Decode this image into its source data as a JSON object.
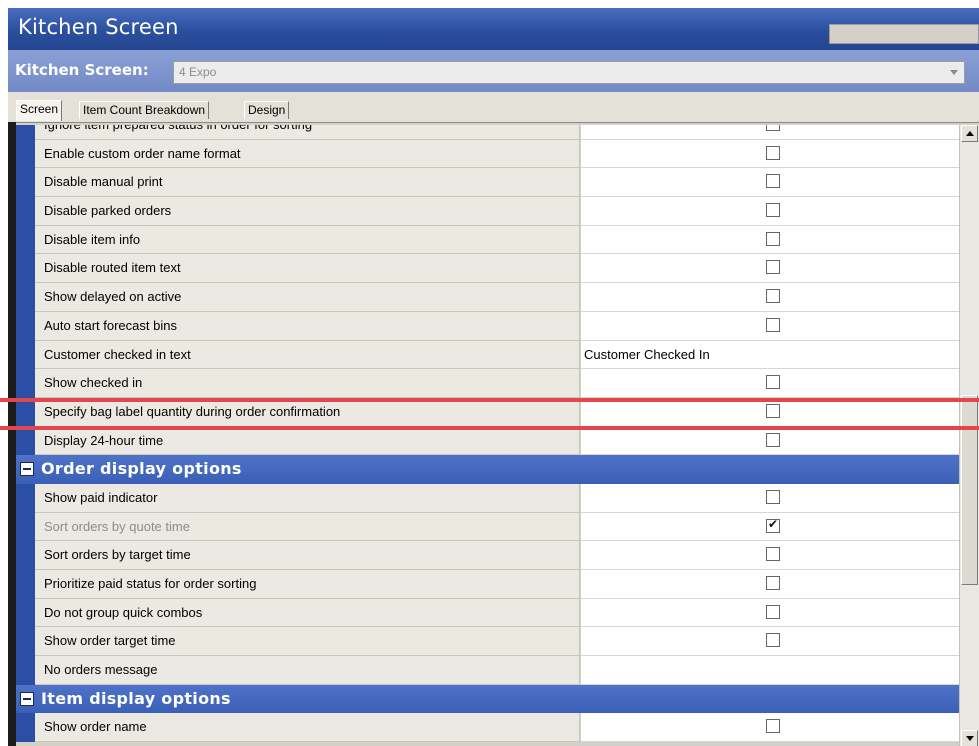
{
  "window": {
    "title": "Kitchen Screen"
  },
  "selector": {
    "label": "Kitchen Screen:",
    "value": "4 Expo"
  },
  "tabs": [
    "Screen",
    "Item Count Breakdown",
    "Design"
  ],
  "grid": {
    "top_partial_row": "Ignore item prepared status in order for sorting",
    "screen_rows": [
      {
        "label": "Enable custom order name format",
        "value_type": "checkbox",
        "checked": false
      },
      {
        "label": "Disable manual print",
        "value_type": "checkbox",
        "checked": false
      },
      {
        "label": "Disable parked orders",
        "value_type": "checkbox",
        "checked": false
      },
      {
        "label": "Disable item info",
        "value_type": "checkbox",
        "checked": false
      },
      {
        "label": "Disable routed item text",
        "value_type": "checkbox",
        "checked": false
      },
      {
        "label": "Show delayed on active",
        "value_type": "checkbox",
        "checked": false
      },
      {
        "label": "Auto start forecast bins",
        "value_type": "checkbox",
        "checked": false
      },
      {
        "label": "Customer checked in text",
        "value_type": "text",
        "value": "Customer Checked In"
      },
      {
        "label": "Show checked in",
        "value_type": "checkbox",
        "checked": false
      },
      {
        "label": "Specify bag label quantity during order confirmation",
        "value_type": "checkbox",
        "checked": false
      },
      {
        "label": "Display 24-hour time",
        "value_type": "checkbox",
        "checked": false
      }
    ],
    "groups": [
      {
        "label": "Order display options",
        "rows": [
          {
            "label": "Show paid indicator",
            "value_type": "checkbox",
            "checked": false
          },
          {
            "label": "Sort orders by quote time",
            "value_type": "checkbox",
            "checked": true,
            "disabled": true
          },
          {
            "label": "Sort orders by target time",
            "value_type": "checkbox",
            "checked": false
          },
          {
            "label": "Prioritize paid status for order sorting",
            "value_type": "checkbox",
            "checked": false
          },
          {
            "label": "Do not group quick combos",
            "value_type": "checkbox",
            "checked": false
          },
          {
            "label": "Show order target time",
            "value_type": "checkbox",
            "checked": false
          },
          {
            "label": "No orders message",
            "value_type": "text",
            "value": ""
          }
        ]
      },
      {
        "label": "Item display options",
        "rows": [
          {
            "label": "Show order name",
            "value_type": "checkbox",
            "checked": false
          }
        ]
      }
    ]
  },
  "colors": {
    "title_bar": "#2b4f9f",
    "selector_bar": "#7a8fca",
    "group_header": "#3f63b9",
    "row_stripe": "#2b4fa4",
    "highlight": "#e2474d"
  }
}
